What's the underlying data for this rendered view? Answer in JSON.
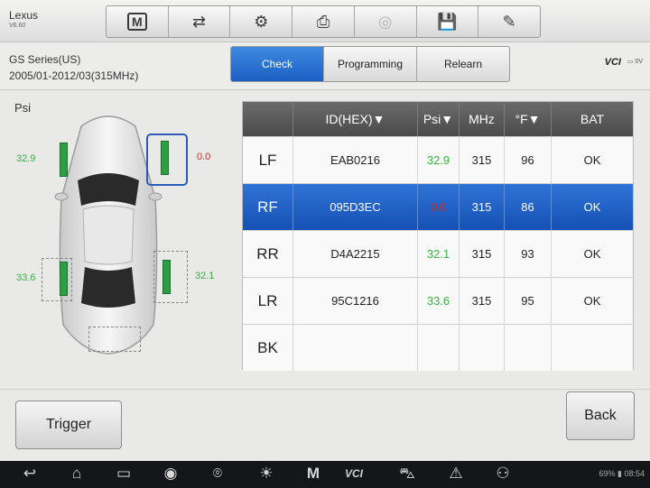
{
  "app": {
    "make": "Lexus",
    "sub": "V6.60"
  },
  "toolbar": {
    "items": [
      {
        "name": "home-icon",
        "glyph": "M"
      },
      {
        "name": "vehicle-swap-icon",
        "glyph": "⇄"
      },
      {
        "name": "gear-icon",
        "glyph": "⚙"
      },
      {
        "name": "print-icon",
        "glyph": "⎙"
      },
      {
        "name": "help-icon",
        "glyph": "◎"
      },
      {
        "name": "save-icon",
        "glyph": "💾"
      },
      {
        "name": "pen-icon",
        "glyph": "✎"
      }
    ]
  },
  "vehicle": {
    "line1": "GS Series(US)",
    "line2": "2005/01-2012/03(315MHz)"
  },
  "tabs": {
    "check": "Check",
    "programming": "Programming",
    "relearn": "Relearn"
  },
  "status": {
    "vci": "VCI",
    "battery": "0V"
  },
  "diagram": {
    "unit": "Psi",
    "lf": "32.9",
    "rf": "0.0",
    "rr": "32.1",
    "lr": "33.6"
  },
  "table": {
    "headers": [
      "",
      "ID(HEX)▼",
      "Psi▼",
      "MHz",
      "°F▼",
      "BAT"
    ],
    "rows": [
      {
        "pos": "LF",
        "id": "EAB0216",
        "psi": "32.9",
        "mhz": "315",
        "temp": "96",
        "bat": "OK"
      },
      {
        "pos": "RF",
        "id": "095D3EC",
        "psi": "0.0",
        "mhz": "315",
        "temp": "86",
        "bat": "OK"
      },
      {
        "pos": "RR",
        "id": "D4A2215",
        "psi": "32.1",
        "mhz": "315",
        "temp": "93",
        "bat": "OK"
      },
      {
        "pos": "LR",
        "id": "95C1216",
        "psi": "33.6",
        "mhz": "315",
        "temp": "95",
        "bat": "OK"
      },
      {
        "pos": "BK",
        "id": "",
        "psi": "",
        "mhz": "",
        "temp": "",
        "bat": ""
      }
    ]
  },
  "buttons": {
    "trigger": "Trigger",
    "back": "Back"
  },
  "navbar": {
    "vci": "VCI",
    "battery_pct": "69%",
    "time": "08:54"
  },
  "colors": {
    "accent": "#1f62c9",
    "ok_green": "#3cb043",
    "alert_red": "#c0302a"
  }
}
